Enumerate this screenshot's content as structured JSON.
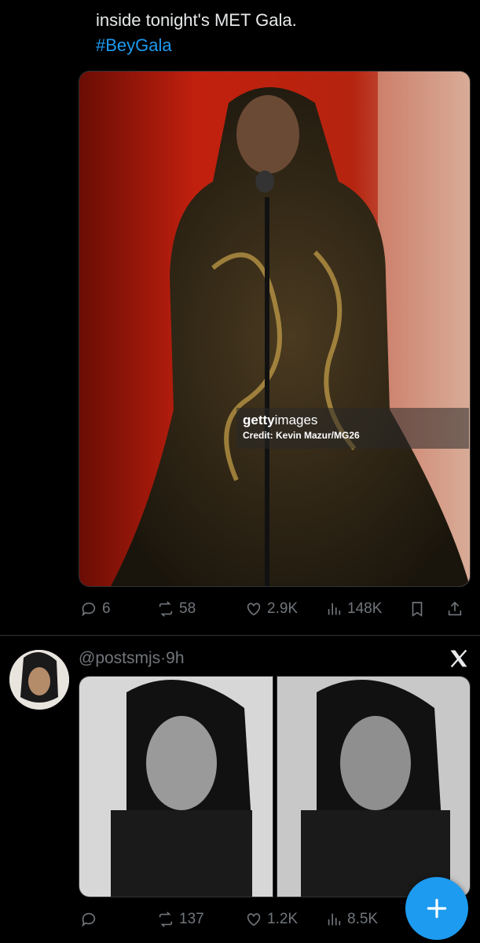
{
  "tweet1": {
    "text": "inside tonight's MET Gala.",
    "hashtag": "#BeyGala",
    "photo": {
      "watermark_brand": "getty",
      "watermark_brand2": "images",
      "credit": "Credit: Kevin Mazur/MG26"
    },
    "stats": {
      "replies": "6",
      "reposts": "58",
      "likes": "2.9K",
      "views": "148K"
    }
  },
  "tweet2": {
    "handle": "@postsmjs",
    "separator": "·",
    "time": "9h",
    "stats": {
      "replies": "",
      "reposts": "137",
      "likes": "1.2K",
      "views": "8.5K"
    }
  },
  "icons": {
    "reply": "reply-icon",
    "repost": "repost-icon",
    "like": "heart-icon",
    "views": "views-icon",
    "bookmark": "bookmark-icon",
    "share": "share-icon",
    "brand": "x-logo-icon",
    "compose": "plus-icon"
  },
  "colors": {
    "background": "#000000",
    "text": "#e7e9ea",
    "muted": "#71767b",
    "accent": "#1d9bf0"
  }
}
